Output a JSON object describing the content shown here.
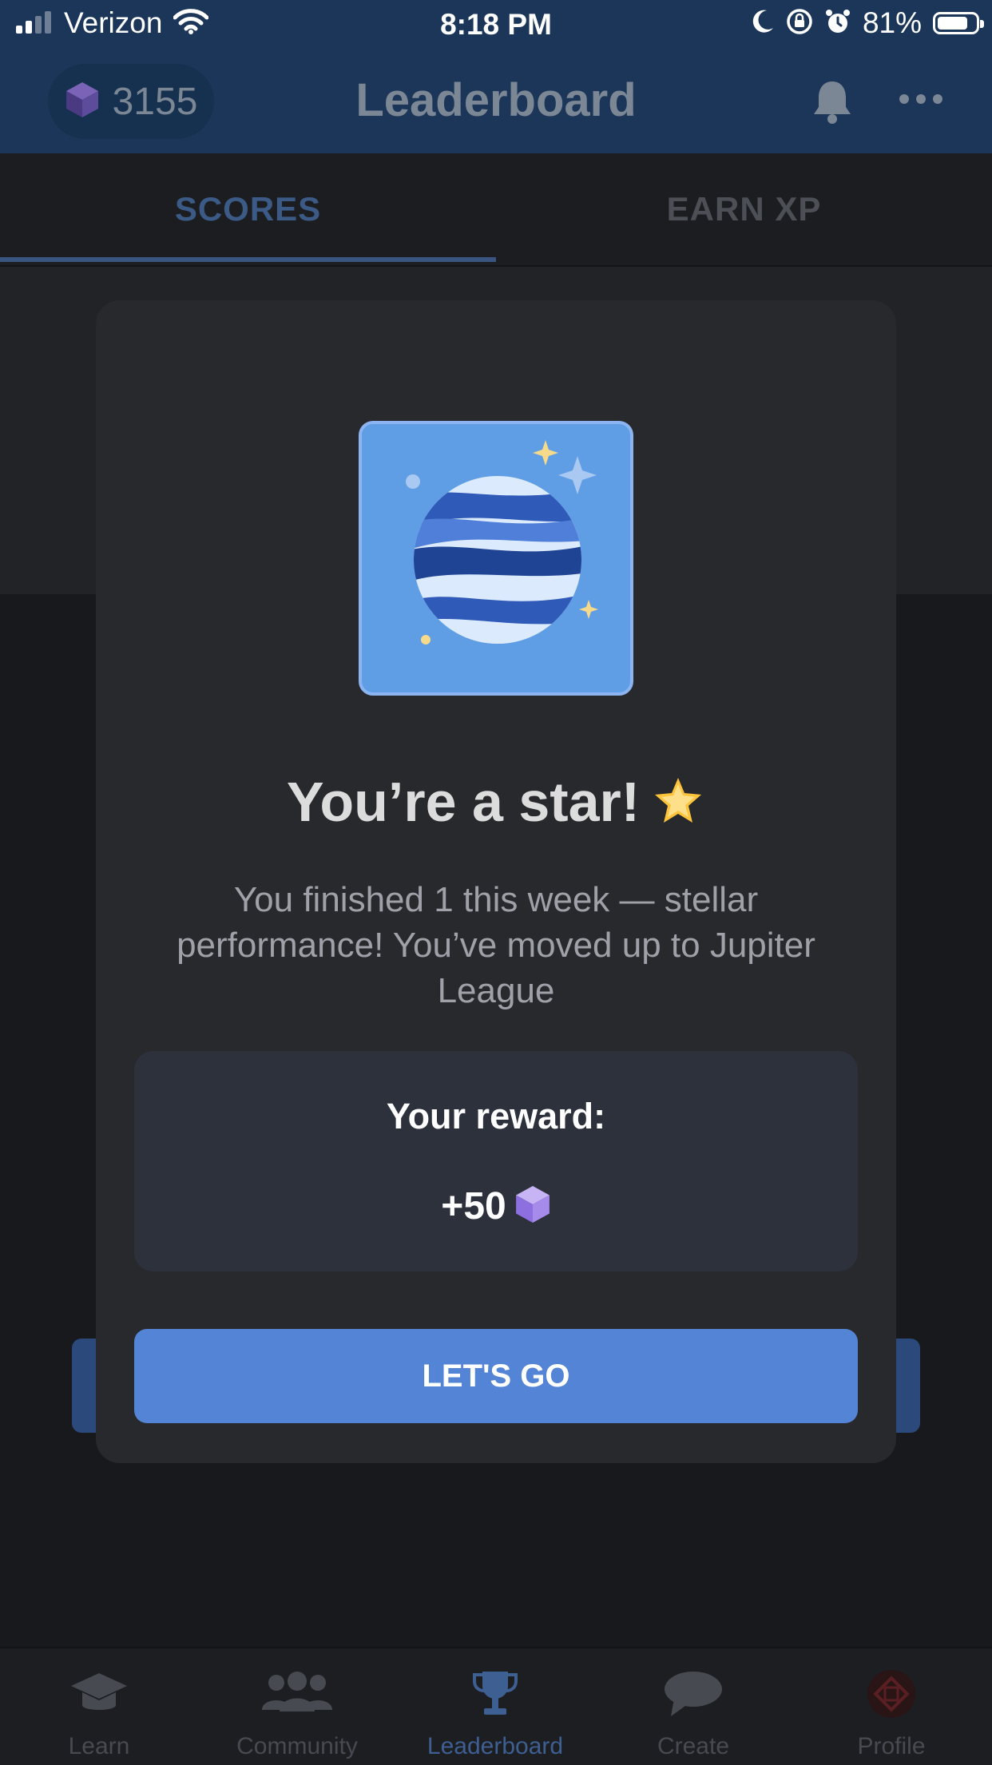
{
  "status_bar": {
    "carrier": "Verizon",
    "time": "8:18 PM",
    "battery": "81%",
    "battery_level": 0.81,
    "icons": [
      "signal-icon",
      "wifi-icon",
      "moon-icon",
      "rotation-lock-icon",
      "alarm-icon",
      "battery-icon"
    ]
  },
  "header": {
    "gem_count": "3155",
    "title": "Leaderboard",
    "icons": [
      "gem-icon",
      "bell-icon",
      "more-icon"
    ]
  },
  "tabs": [
    {
      "label": "SCORES",
      "active": true
    },
    {
      "label": "EARN XP",
      "active": false
    }
  ],
  "modal": {
    "badge_icon": "planet-jupiter-icon",
    "title": "You’re a star!",
    "title_emoji": "glowing-star-icon",
    "message": "You finished 1 this week — stellar performance! You’ve moved up to Jupiter League",
    "reward_label": "Your reward:",
    "reward_value": "+50",
    "reward_icon": "gem-icon",
    "cta_label": "LET'S GO"
  },
  "bottom_nav": [
    {
      "label": "Learn",
      "icon": "graduation-cap-icon",
      "active": false
    },
    {
      "label": "Community",
      "icon": "people-icon",
      "active": false
    },
    {
      "label": "Leaderboard",
      "icon": "trophy-icon",
      "active": true
    },
    {
      "label": "Create",
      "icon": "chat-bubble-icon",
      "active": false
    },
    {
      "label": "Profile",
      "icon": "avatar-icon",
      "active": false
    }
  ],
  "colors": {
    "header_bg": "#1b3658",
    "accent": "#5484d6",
    "modal_bg": "#28292d",
    "active_tab": "#3c5a86"
  }
}
